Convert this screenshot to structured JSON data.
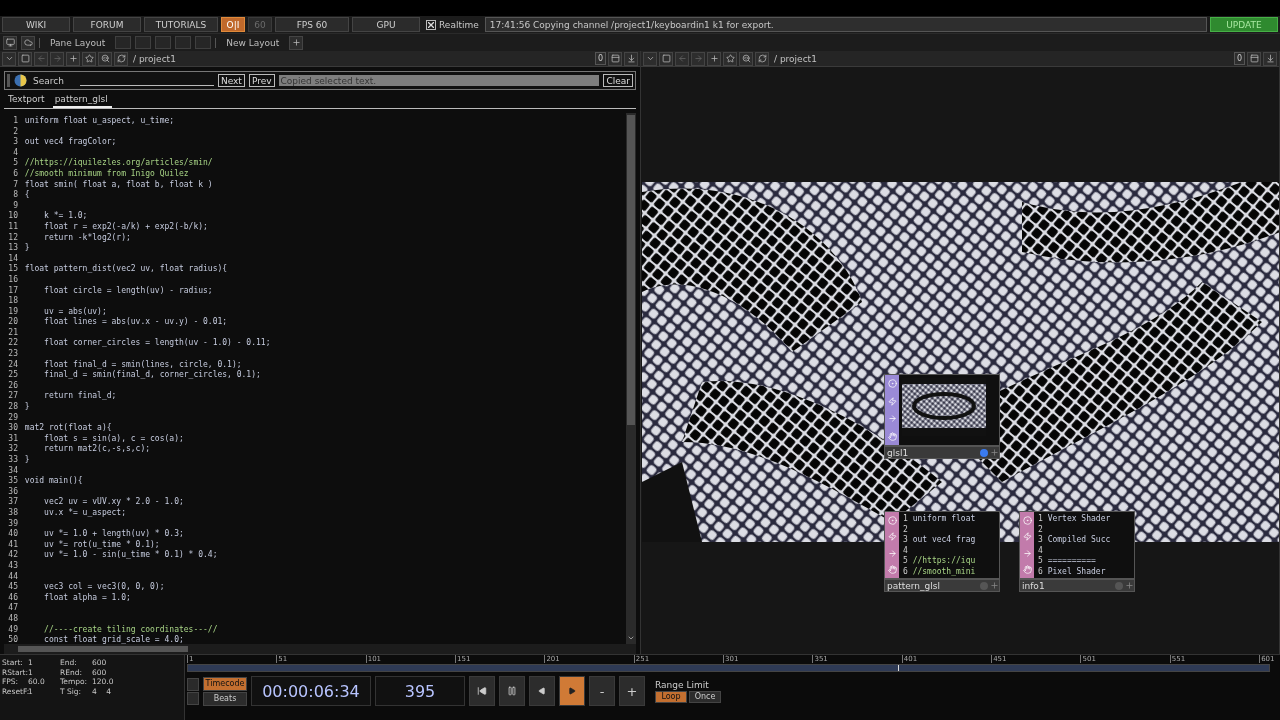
{
  "menu_bar": {
    "items": [
      {
        "kind": "button",
        "label": "WIKI"
      },
      {
        "kind": "button",
        "label": "FORUM"
      },
      {
        "kind": "button",
        "label": "TUTORIALS"
      },
      {
        "kind": "toggle",
        "label": "O|I",
        "on": true
      },
      {
        "kind": "toggle",
        "label": "60",
        "on": false
      },
      {
        "kind": "button",
        "label": "FPS  60"
      },
      {
        "kind": "button",
        "label": "GPU"
      },
      {
        "kind": "checkbox",
        "label": "Realtime",
        "checked": true
      },
      {
        "kind": "message",
        "label": "17:41:56 Copying channel /project1/keyboardin1 k1 for export."
      },
      {
        "kind": "update",
        "label": "UPDATE"
      }
    ]
  },
  "layout_bar": {
    "label": "Pane Layout",
    "new_layout": "New Layout"
  },
  "left_pane": {
    "path": "/ project1",
    "counter": "0"
  },
  "right_pane": {
    "path": "/ project1",
    "counter": "0"
  },
  "textport": {
    "search": {
      "label": "Search",
      "next": "Next",
      "prev": "Prev",
      "status": "Copied selected text.",
      "clear": "Clear"
    },
    "tabs": [
      {
        "label": "Textport",
        "selected": false
      },
      {
        "label": "pattern_glsl",
        "selected": true
      }
    ],
    "lines": [
      {
        "number": "1",
        "kind": "code",
        "text": "uniform float u_aspect, u_time;"
      },
      {
        "number": "2"
      },
      {
        "number": "3",
        "kind": "code",
        "text": "out vec4 fragColor;"
      },
      {
        "number": "4"
      },
      {
        "number": "5",
        "kind": "comment",
        "text": "//https://iquilezles.org/articles/smin/"
      },
      {
        "number": "6",
        "kind": "comment",
        "text": "//smooth minimum from Inigo Quilez"
      },
      {
        "number": "7",
        "kind": "code",
        "text": "float smin( float a, float b, float k )"
      },
      {
        "number": "8",
        "kind": "code",
        "text": "{"
      },
      {
        "number": "9"
      },
      {
        "number": "10",
        "kind": "code",
        "text": "    k *= 1.0;"
      },
      {
        "number": "11",
        "kind": "code",
        "text": "    float r = exp2(-a/k) + exp2(-b/k);"
      },
      {
        "number": "12",
        "kind": "code",
        "text": "    return -k*log2(r);"
      },
      {
        "number": "13",
        "kind": "code",
        "text": "}"
      },
      {
        "number": "14"
      },
      {
        "number": "15",
        "kind": "code",
        "text": "float pattern_dist(vec2 uv, float radius){"
      },
      {
        "number": "16"
      },
      {
        "number": "17",
        "kind": "code",
        "text": "    float circle = length(uv) - radius;"
      },
      {
        "number": "18"
      },
      {
        "number": "19",
        "kind": "code",
        "text": "    uv = abs(uv);"
      },
      {
        "number": "20",
        "kind": "code",
        "text": "    float lines = abs(uv.x - uv.y) - 0.01;"
      },
      {
        "number": "21"
      },
      {
        "number": "22",
        "kind": "code",
        "text": "    float corner_circles = length(uv - 1.0) - 0.11;"
      },
      {
        "number": "23"
      },
      {
        "number": "24",
        "kind": "code",
        "text": "    float final_d = smin(lines, circle, 0.1);"
      },
      {
        "number": "25",
        "kind": "code",
        "text": "    final_d = smin(final_d, corner_circles, 0.1);"
      },
      {
        "number": "26"
      },
      {
        "number": "27",
        "kind": "code",
        "text": "    return final_d;"
      },
      {
        "number": "28",
        "kind": "code",
        "text": "}"
      },
      {
        "number": "29"
      },
      {
        "number": "30",
        "kind": "code",
        "text": "mat2 rot(float a){"
      },
      {
        "number": "31",
        "kind": "code",
        "text": "    float s = sin(a), c = cos(a);"
      },
      {
        "number": "32",
        "kind": "code",
        "text": "    return mat2(c,-s,s,c);"
      },
      {
        "number": "33",
        "kind": "code",
        "text": "}"
      },
      {
        "number": "34"
      },
      {
        "number": "35",
        "kind": "code",
        "text": "void main(){"
      },
      {
        "number": "36"
      },
      {
        "number": "37",
        "kind": "code",
        "text": "    vec2 uv = vUV.xy * 2.0 - 1.0;"
      },
      {
        "number": "38",
        "kind": "code",
        "text": "    uv.x *= u_aspect;"
      },
      {
        "number": "39"
      },
      {
        "number": "40",
        "kind": "code",
        "text": "    uv *= 1.0 + length(uv) * 0.3;"
      },
      {
        "number": "41",
        "kind": "code",
        "text": "    uv *= rot(u_time * 0.1);"
      },
      {
        "number": "42",
        "kind": "code",
        "text": "    uv *= 1.0 - sin(u_time * 0.1) * 0.4;"
      },
      {
        "number": "43"
      },
      {
        "number": "44"
      },
      {
        "number": "45",
        "kind": "code",
        "text": "    vec3 col = vec3(0, 0, 0);"
      },
      {
        "number": "46",
        "kind": "code",
        "text": "    float alpha = 1.0;"
      },
      {
        "number": "47"
      },
      {
        "number": "48"
      },
      {
        "number": "49",
        "kind": "comment",
        "text": "    //----create tiling coordinates---//"
      },
      {
        "number": "50",
        "kind": "code",
        "text": "    const float grid_scale = 4.0;"
      }
    ]
  },
  "network": {
    "nodes": [
      {
        "name": "glsl1",
        "kind": "top",
        "color": "#9a8ad6"
      },
      {
        "name": "pattern_glsl",
        "kind": "dat",
        "color": "#c27bab",
        "lines": [
          {
            "number": "1",
            "kind": "code",
            "text": "uniform float"
          },
          {
            "number": "2"
          },
          {
            "number": "3",
            "kind": "code",
            "text": "out vec4 frag"
          },
          {
            "number": "4"
          },
          {
            "number": "5",
            "kind": "comment",
            "text": "//https://iqu"
          },
          {
            "number": "6",
            "kind": "comment",
            "text": "//smooth_mini"
          }
        ]
      },
      {
        "name": "info1",
        "kind": "dat",
        "color": "#c27bab",
        "lines": [
          {
            "number": "1",
            "kind": "code",
            "text": "Vertex Shader"
          },
          {
            "number": "2"
          },
          {
            "number": "3",
            "kind": "code",
            "text": "Compiled Succ"
          },
          {
            "number": "4"
          },
          {
            "number": "5",
            "kind": "code",
            "text": "=========="
          },
          {
            "number": "6",
            "kind": "code",
            "text": "Pixel Shader"
          }
        ]
      }
    ]
  },
  "timeline": {
    "info": [
      {
        "label": "Start:",
        "value": "1"
      },
      {
        "label": "End:",
        "value": "600"
      },
      {
        "label": "RStart:",
        "value": "1"
      },
      {
        "label": "REnd:",
        "value": "600"
      },
      {
        "label": "FPS:",
        "value": "60.0"
      },
      {
        "label": "Tempo:",
        "value": "120.0"
      },
      {
        "label": "ResetF:",
        "value": "1"
      },
      {
        "label": "T Sig:",
        "value": "4    4"
      }
    ],
    "ruler": [
      "1",
      "51",
      "101",
      "151",
      "201",
      "251",
      "301",
      "351",
      "401",
      "451",
      "501",
      "551",
      "601"
    ],
    "playhead": {
      "level": 0.657
    },
    "modes": [
      {
        "label": "Timecode",
        "selected": true
      },
      {
        "label": "Beats",
        "selected": false
      }
    ],
    "timecode": "00:00:06:34",
    "frame": "395",
    "transport": [
      {
        "kind": "start",
        "selected": false
      },
      {
        "kind": "pause",
        "selected": false
      },
      {
        "kind": "back",
        "selected": false
      },
      {
        "kind": "play",
        "selected": true
      },
      {
        "kind": "minus",
        "label": "-",
        "selected": false
      },
      {
        "kind": "plus",
        "label": "+",
        "selected": false
      }
    ],
    "range_label": "Range Limit",
    "range_modes": [
      {
        "label": "Loop",
        "selected": true
      },
      {
        "label": "Once",
        "selected": false
      }
    ]
  }
}
